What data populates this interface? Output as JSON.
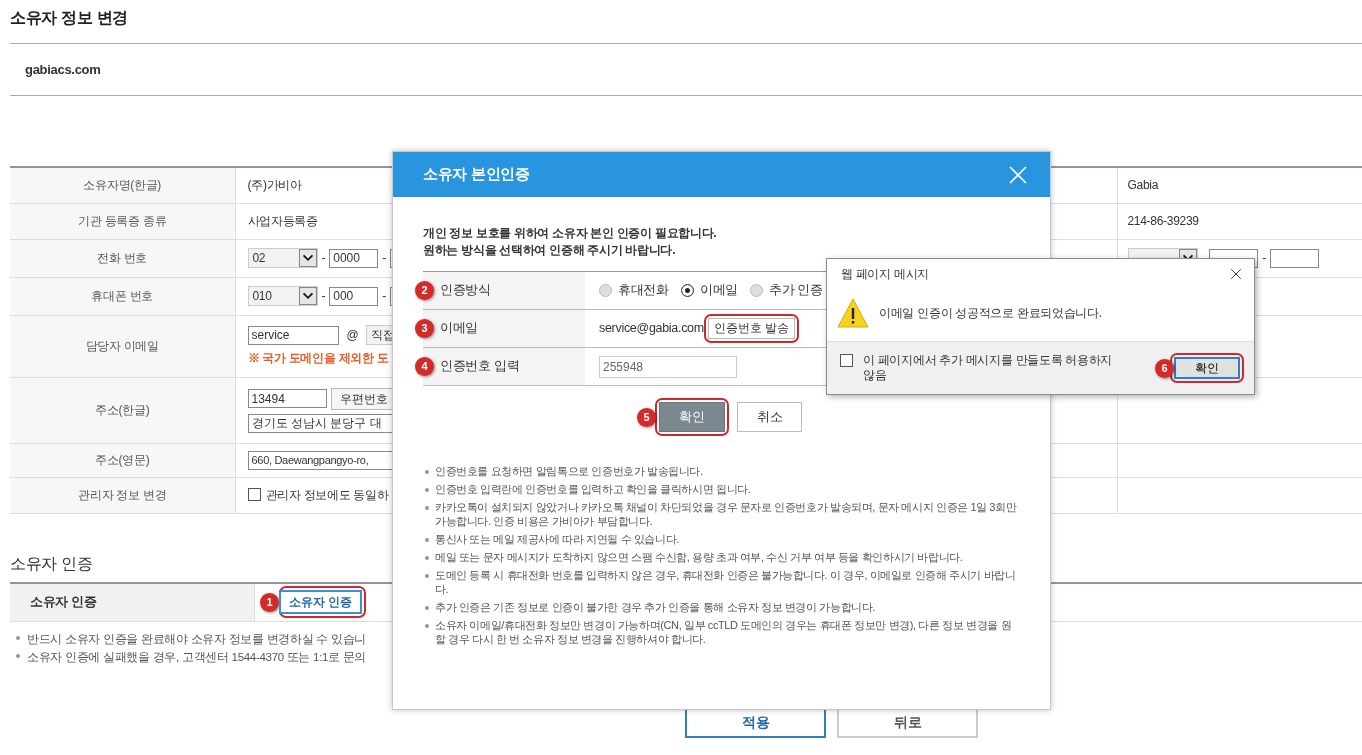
{
  "page": {
    "title": "소유자 정보 변경",
    "domain": "gabiacs.com"
  },
  "owner_table": {
    "rows": [
      {
        "kind": "text",
        "label": "소유자명(한글)",
        "value": "(주)가비아",
        "right_value": "Gabia"
      },
      {
        "kind": "text",
        "label": "기관 등록증 종류",
        "value": "사업자등록증",
        "right_value": "214-86-39239"
      },
      {
        "kind": "phone",
        "label": "전화 번호",
        "select": "02",
        "separator": "-",
        "part_2": "0000",
        "right_phone": true
      },
      {
        "kind": "phone",
        "label": "휴대폰 번호",
        "select": "010",
        "separator": "-",
        "part_2": "000"
      },
      {
        "kind": "email",
        "label": "담당자 이메일",
        "local": "service",
        "at": "@",
        "domain_select": "직접",
        "notice": "※ 국가 도메인을 제외한 도"
      },
      {
        "kind": "address",
        "label": "주소(한글)",
        "postcode": "13494",
        "button": "우편번호",
        "address": "경기도 성남시 분당구 대"
      },
      {
        "kind": "address_en",
        "label": "주소(영문)",
        "address": "660, Daewangpangyo-ro,"
      },
      {
        "kind": "checkbox",
        "label": "관리자 정보 변경",
        "checked": false,
        "text": "관리자 정보에도 동일하"
      }
    ]
  },
  "verify": {
    "heading": "소유자 인증",
    "label": "소유자 인증",
    "button": "소유자 인증",
    "marker": "1",
    "highlighted": true,
    "notes": [
      "반드시 소유자 인증을 완료해야 소유자 정보를 변경하실 수 있습니",
      "소유자 인증에 실패했을 경우, 고객센터 1544-4370 또는 1:1로 문의"
    ]
  },
  "actions": [
    {
      "label": "적용",
      "kind": "primary"
    },
    {
      "label": "뒤로",
      "kind": "secondary"
    }
  ],
  "modal": {
    "title": "소유자 본인인증",
    "intro": [
      "개인 정보 보호를 위하여 소유자 본인 인증이 필요합니다.",
      "원하는 방식을 선택하여 인증해 주시기 바랍니다."
    ],
    "rows": [
      {
        "kind": "radios",
        "marker": "2",
        "label": "인증방식",
        "options": [
          {
            "label": "휴대전화",
            "selected": false
          },
          {
            "label": "이메일",
            "selected": true
          },
          {
            "label": "추가 인증",
            "selected": false
          }
        ]
      },
      {
        "kind": "email",
        "marker": "3",
        "label": "이메일",
        "value": "service@gabia.com",
        "button": "인증번호 발송",
        "highlighted": true
      },
      {
        "kind": "input",
        "marker": "4",
        "label": "인증번호 입력",
        "value": "255948"
      }
    ],
    "buttons": [
      {
        "label": "확인",
        "kind": "primary",
        "marker": "5",
        "highlighted": true
      },
      {
        "label": "취소",
        "kind": "secondary",
        "highlighted": false
      }
    ],
    "notes": [
      "인증번호를 요청하면 알림톡으로 인증번호가 발송됩니다.",
      "인증번호 입력란에 인증번호를 입력하고 확인을 클릭하시면 됩니다.",
      "카카오톡이 설치되지 않았거나 카카오톡 채널이 차단되었을 경우 문자로 인증번호가 발송되며, 문자 메시지 인증은 1일 3회만 가능합니다. 인증 비용은 가비아가 부담합니다.",
      "통신사 또는 메일 제공사에 따라 지연될 수 있습니다.",
      "메일 또는 문자 메시지가 도착하지 않으면 스팸 수신함, 용량 초과 여부, 수신 거부 여부 등을 확인하시기 바랍니다.",
      "도메인 등록 시 휴대전화 번호를 입력하지 않은 경우, 휴대전화 인증은 불가능합니다. 이 경우, 이메일로 인증해 주시기 바랍니다.",
      "추가 인증은 기존 정보로 인증이 불가한 경우 추가 인증을 통해 소유자 정보 변경이 가능합니다.",
      "소유자 이메일/휴대전화 정보만 변경이 가능하며(CN, 일부 ccTLD 도메인의 경우는 휴대폰 정보만 변경), 다른 정보 변경을 원할 경우 다시 한 번 소유자 정보 변경을 진행하셔야 합니다."
    ]
  },
  "alert": {
    "title": "웹 페이지 메시지",
    "message": "이메일 인증이 성공적으로 완료되었습니다.",
    "checkbox": {
      "label": "이 페이지에서 추가 메시지를 만들도록 허용하지 않음",
      "checked": false
    },
    "button": {
      "label": "확인",
      "marker": "6",
      "highlighted": true
    }
  }
}
